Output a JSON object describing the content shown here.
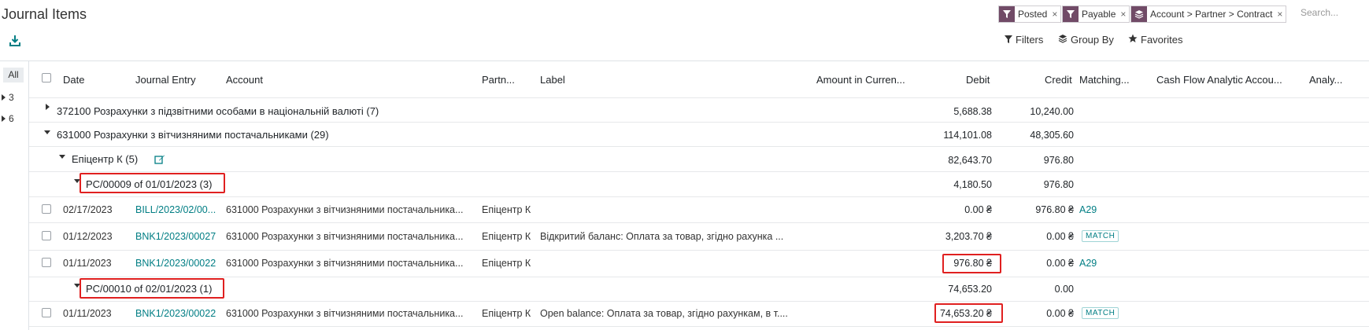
{
  "page": {
    "title": "Journal Items"
  },
  "search": {
    "facets": [
      {
        "icon": "filter-icon",
        "label": "Posted"
      },
      {
        "icon": "filter-icon",
        "label": "Payable"
      },
      {
        "icon": "group-by-icon",
        "label": "Account > Partner > Contract"
      }
    ],
    "placeholder": "Search..."
  },
  "toolbar": {
    "filters": "Filters",
    "group_by": "Group By",
    "favorites": "Favorites"
  },
  "sidebar": {
    "items": [
      "All",
      "3",
      "6"
    ]
  },
  "columns": {
    "date": "Date",
    "journal_entry": "Journal Entry",
    "account": "Account",
    "partner": "Partn...",
    "label": "Label",
    "amount_currency": "Amount in Curren...",
    "debit": "Debit",
    "credit": "Credit",
    "matching": "Matching...",
    "cash_flow": "Cash Flow Analytic Accou...",
    "analytic": "Analy..."
  },
  "groups": {
    "g1": {
      "label": "372100 Розрахунки з підзвітними особами в національній валюті (7)",
      "debit": "5,688.38",
      "credit": "10,240.00"
    },
    "g2": {
      "label": "631000 Розрахунки з вітчизняними постачальниками (29)",
      "debit": "114,101.08",
      "credit": "48,305.60"
    },
    "g3": {
      "label": "Епіцентр К (5)",
      "debit": "82,643.70",
      "credit": "976.80"
    },
    "g4": {
      "label": "PC/00009 of 01/01/2023 (3)",
      "debit": "4,180.50",
      "credit": "976.80"
    },
    "g5": {
      "label": "PC/00010 of 02/01/2023 (1)",
      "debit": "74,653.20",
      "credit": "0.00"
    }
  },
  "rows": [
    {
      "date": "02/17/2023",
      "entry": "BILL/2023/02/00...",
      "account": "631000 Розрахунки з вітчизняними постачальника...",
      "partner": "Епіцентр К",
      "label": "",
      "debit": "0.00 ₴",
      "credit": "976.80 ₴",
      "matching": "A29"
    },
    {
      "date": "01/12/2023",
      "entry": "BNK1/2023/00027",
      "account": "631000 Розрахунки з вітчизняними постачальника...",
      "partner": "Епіцентр К",
      "label": "Відкритий баланс: Оплата за товар, згідно рахунка ...",
      "debit": "3,203.70 ₴",
      "credit": "0.00 ₴",
      "matching": "MATCH"
    },
    {
      "date": "01/11/2023",
      "entry": "BNK1/2023/00022",
      "account": "631000 Розрахунки з вітчизняними постачальника...",
      "partner": "Епіцентр К",
      "label": "",
      "debit": "976.80 ₴",
      "credit": "0.00 ₴",
      "matching": "A29"
    },
    {
      "date": "01/11/2023",
      "entry": "BNK1/2023/00022",
      "account": "631000 Розрахунки з вітчизняними постачальника...",
      "partner": "Епіцентр К",
      "label": "Open balance: Оплата за товар, згідно рахункам, в т....",
      "debit": "74,653.20 ₴",
      "credit": "0.00 ₴",
      "matching": "MATCH"
    }
  ],
  "colors": {
    "brand": "#714b67",
    "link": "#017e84",
    "highlight": "#e02020"
  }
}
